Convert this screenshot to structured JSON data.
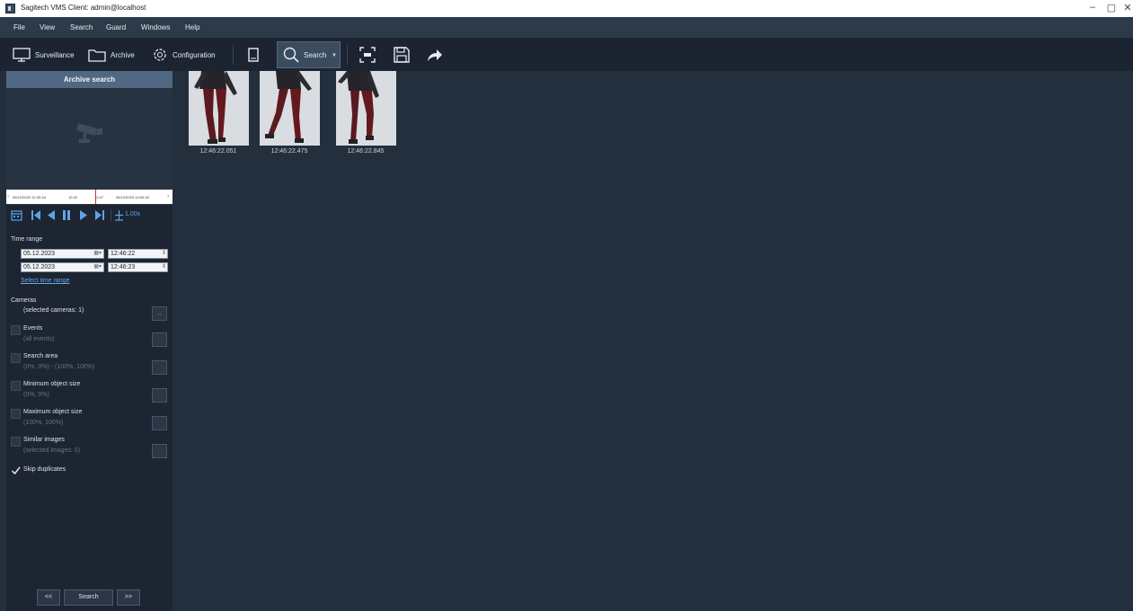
{
  "window": {
    "title": "Sagitech VMS Client: admin@localhost",
    "controls": [
      "–",
      "▢",
      "✕"
    ]
  },
  "menu": [
    "File",
    "View",
    "Search",
    "Guard",
    "Windows",
    "Help"
  ],
  "toolbar": {
    "surveillance": "Surveillance",
    "archive": "Archive",
    "configuration": "Configuration",
    "search": "Search"
  },
  "panel": {
    "header": "Archive search",
    "timeline": {
      "start": "05/12/2023 12:30:18",
      "tick1": "12:42",
      "tick2": "12:47",
      "end": "05/12/2023 13:00:18"
    },
    "speed": "1.00x",
    "time_range_label": "Time range",
    "from_date": "05.12.2023",
    "from_time": "12:46:22",
    "to_date": "05.12.2023",
    "to_time": "12:46:23",
    "select_time_range": "Select time range",
    "cameras_label": "Cameras",
    "cameras_value": "(selected cameras: 1)",
    "cameras_btn": "..",
    "events_label": "Events",
    "events_value": "(all events)",
    "search_area_label": "Search area",
    "search_area_value": "(0%, 0%) - (100%, 100%)",
    "min_size_label": "Minimum object size",
    "min_size_value": "(0%, 0%)",
    "max_size_label": "Maximum object size",
    "max_size_value": "(100%, 100%)",
    "similar_label": "Similar images",
    "similar_value": "(selected images: 0)",
    "skip_label": "Skip duplicates",
    "prev_btn": "<<",
    "search_btn": "Search",
    "next_btn": ">>"
  },
  "results": [
    {
      "time": "12:46:22.051"
    },
    {
      "time": "12:46:22.475"
    },
    {
      "time": "12:46:22.845"
    }
  ],
  "colors": {
    "background": "#242f3d",
    "panel": "#1c2531",
    "toolbar": "#1b2430",
    "menubar": "#2c3a4a",
    "header": "#516883",
    "accent": "#5fa3ea"
  }
}
